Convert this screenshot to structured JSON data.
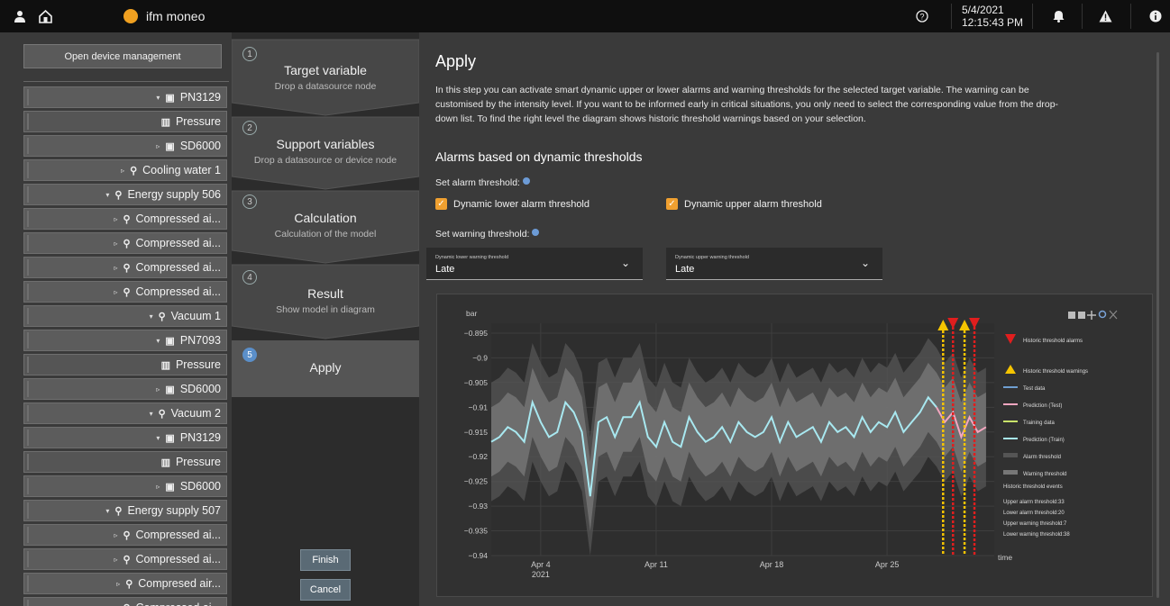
{
  "topbar": {
    "app_name": "ifm moneo",
    "date": "5/4/2021",
    "time": "12:15:43 PM",
    "help_glyph": "?",
    "icons": [
      "user-icon",
      "home-icon",
      "logo-icon",
      "help-icon",
      "bell-icon",
      "warning-icon",
      "info-icon"
    ]
  },
  "sidebar": {
    "open_device_management": "Open device management",
    "tree": [
      {
        "label": "PN3129",
        "kind": "device",
        "toggle": "▾"
      },
      {
        "label": "Pressure",
        "kind": "signal",
        "toggle": ""
      },
      {
        "label": "SD6000",
        "kind": "device",
        "toggle": "▹"
      },
      {
        "label": "Cooling water 1",
        "kind": "group",
        "toggle": "▹"
      },
      {
        "label": "Energy supply 506",
        "kind": "group",
        "toggle": "▾"
      },
      {
        "label": "Compressed ai...",
        "kind": "group",
        "toggle": "▹"
      },
      {
        "label": "Compressed ai...",
        "kind": "group",
        "toggle": "▹"
      },
      {
        "label": "Compressed ai...",
        "kind": "group",
        "toggle": "▹"
      },
      {
        "label": "Compressed ai...",
        "kind": "group",
        "toggle": "▹"
      },
      {
        "label": "Vacuum 1",
        "kind": "group",
        "toggle": "▾"
      },
      {
        "label": "PN7093",
        "kind": "device",
        "toggle": "▾"
      },
      {
        "label": "Pressure",
        "kind": "signal",
        "toggle": ""
      },
      {
        "label": "SD6000",
        "kind": "device",
        "toggle": "▹"
      },
      {
        "label": "Vacuum 2",
        "kind": "group",
        "toggle": "▾"
      },
      {
        "label": "PN3129",
        "kind": "device",
        "toggle": "▾"
      },
      {
        "label": "Pressure",
        "kind": "signal",
        "toggle": ""
      },
      {
        "label": "SD6000",
        "kind": "device",
        "toggle": "▹"
      },
      {
        "label": "Energy supply 507",
        "kind": "group",
        "toggle": "▾"
      },
      {
        "label": "Compressed ai...",
        "kind": "group",
        "toggle": "▹"
      },
      {
        "label": "Compressed ai...",
        "kind": "group",
        "toggle": "▹"
      },
      {
        "label": "Compresed air...",
        "kind": "group",
        "toggle": "▹"
      },
      {
        "label": "Compressed ai...",
        "kind": "group",
        "toggle": "▹"
      }
    ]
  },
  "steps": [
    {
      "num": "1",
      "title": "Target variable",
      "sub": "Drop a datasource node"
    },
    {
      "num": "2",
      "title": "Support variables",
      "sub": "Drop a datasource or device node"
    },
    {
      "num": "3",
      "title": "Calculation",
      "sub": "Calculation of the model"
    },
    {
      "num": "4",
      "title": "Result",
      "sub": "Show model in diagram"
    },
    {
      "num": "5",
      "title": "Apply",
      "sub": ""
    }
  ],
  "actions": {
    "finish": "Finish",
    "cancel": "Cancel"
  },
  "main": {
    "title": "Apply",
    "description": "In this step you can activate smart dynamic upper or lower alarms and warning thresholds for the selected target variable. The warning can be customised by the intensity level. If you want to be informed early in critical situations, you only need to select the corresponding value from the drop-down list. To find the right level the diagram shows historic threshold warnings based on your selection.",
    "alarm_heading": "Alarms based on dynamic thresholds",
    "set_alarm_label": "Set alarm threshold:",
    "lower_alarm_label": "Dynamic lower alarm threshold",
    "upper_alarm_label": "Dynamic upper alarm threshold",
    "lower_alarm_checked": true,
    "upper_alarm_checked": true,
    "set_warning_label": "Set warning threshold:",
    "lower_warning_caption": "Dynamic lower warning threshold",
    "lower_warning_value": "Late",
    "upper_warning_caption": "Dynamic upper warning threshold",
    "upper_warning_value": "Late",
    "checkbox_mark": "✓",
    "chevron": "⌄"
  },
  "chart_data": {
    "type": "line",
    "ylabel": "bar",
    "xlabel": "time",
    "ylim": [
      -0.94,
      -0.893
    ],
    "y_ticks": [
      -0.895,
      -0.9,
      -0.905,
      -0.91,
      -0.915,
      -0.92,
      -0.925,
      -0.93,
      -0.935,
      -0.94
    ],
    "x_ticks": [
      {
        "label": "Apr 4",
        "sub": "2021",
        "day": 4
      },
      {
        "label": "Apr 11",
        "sub": "",
        "day": 11
      },
      {
        "label": "Apr 18",
        "sub": "",
        "day": 18
      },
      {
        "label": "Apr 25",
        "sub": "",
        "day": 25
      }
    ],
    "xlim_days": [
      1,
      31.5
    ],
    "grid": true,
    "legend_position": "right",
    "legend": [
      {
        "label": "Historic threshold alarms",
        "symbol": "triangle-down",
        "color": "#e01e1e"
      },
      {
        "label": "Historic threshold warnings",
        "symbol": "triangle-up",
        "color": "#f5c400"
      },
      {
        "label": "Test data",
        "symbol": "line",
        "color": "#6f9fd1"
      },
      {
        "label": "Prediction (Test)",
        "symbol": "line",
        "color": "#f4a6c0"
      },
      {
        "label": "Training data",
        "symbol": "line",
        "color": "#c9e36a"
      },
      {
        "label": "Prediction (Train)",
        "symbol": "line",
        "color": "#a8e8f0"
      },
      {
        "label": "Alarm threshold",
        "symbol": "band",
        "color": "#555555"
      },
      {
        "label": "Warning threshold",
        "symbol": "band",
        "color": "#777777"
      }
    ],
    "events_title": "Historic threshold events",
    "events": [
      "Upper alarm threshold:33",
      "Lower alarm threshold:20",
      "Upper warning threshold:7",
      "Lower warning threshold:38"
    ],
    "series": [
      {
        "name": "Prediction (Train)",
        "color": "#a8e8f0",
        "x": [
          1.0,
          1.5,
          2.0,
          2.5,
          3.0,
          3.5,
          4.0,
          4.5,
          5.0,
          5.5,
          6.0,
          6.5,
          7.0,
          7.5,
          8.0,
          8.5,
          9.0,
          9.5,
          10.0,
          10.5,
          11.0,
          11.5,
          12.0,
          12.5,
          13.0,
          13.5,
          14.0,
          14.5,
          15.0,
          15.5,
          16.0,
          16.5,
          17.0,
          17.5,
          18.0,
          18.5,
          19.0,
          19.5,
          20.0,
          20.5,
          21.0,
          21.5,
          22.0,
          22.5,
          23.0,
          23.5,
          24.0,
          24.5,
          25.0,
          25.5,
          26.0,
          26.5,
          27.0,
          27.5,
          28.0
        ],
        "y": [
          -0.917,
          -0.916,
          -0.914,
          -0.915,
          -0.917,
          -0.909,
          -0.913,
          -0.916,
          -0.915,
          -0.909,
          -0.911,
          -0.915,
          -0.928,
          -0.913,
          -0.912,
          -0.916,
          -0.912,
          -0.912,
          -0.909,
          -0.916,
          -0.918,
          -0.913,
          -0.917,
          -0.918,
          -0.912,
          -0.915,
          -0.917,
          -0.916,
          -0.914,
          -0.917,
          -0.913,
          -0.915,
          -0.916,
          -0.915,
          -0.912,
          -0.917,
          -0.913,
          -0.916,
          -0.915,
          -0.914,
          -0.917,
          -0.913,
          -0.915,
          -0.914,
          -0.916,
          -0.912,
          -0.915,
          -0.913,
          -0.914,
          -0.911,
          -0.915,
          -0.913,
          -0.911,
          -0.908,
          -0.91
        ]
      },
      {
        "name": "Prediction (Test)",
        "color": "#f4a6c0",
        "x": [
          28.0,
          28.5,
          29.0,
          29.5,
          30.0,
          30.5,
          31.0
        ],
        "y": [
          -0.91,
          -0.913,
          -0.911,
          -0.916,
          -0.912,
          -0.915,
          -0.914
        ]
      }
    ],
    "warning_markers_days": [
      28.4,
      29.7
    ],
    "alarm_markers_days": [
      29.0,
      30.3
    ]
  }
}
